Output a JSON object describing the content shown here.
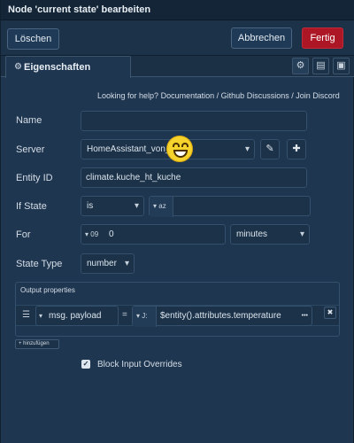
{
  "window": {
    "title": "Node 'current state' bearbeiten"
  },
  "toolbar": {
    "delete_label": "Löschen",
    "cancel_label": "Abbrechen",
    "done_label": "Fertig",
    "done_color": "#ad1625"
  },
  "tabs": {
    "properties_label": "Eigenschaften"
  },
  "help": {
    "prefix": "Looking for help?",
    "documentation": "Documentation",
    "github": "Github Discussions",
    "discord": "Join Discord",
    "separator": "/"
  },
  "form": {
    "name": {
      "label": "Name",
      "value": ""
    },
    "server": {
      "label": "Server",
      "value": "HomeAssistant_von_"
    },
    "entity_id": {
      "label": "Entity ID",
      "value": "climate.kuche_ht_kuche"
    },
    "if_state": {
      "label": "If State",
      "operator": "is",
      "type_icon": "az",
      "value": ""
    },
    "for": {
      "label": "For",
      "type_icon": "09",
      "value": "0",
      "unit": "minutes"
    },
    "state_type": {
      "label": "State Type",
      "value": "number"
    }
  },
  "output": {
    "title": "Output properties",
    "rows": [
      {
        "target": "msg. payload",
        "equals": "=",
        "type_icon": "J:",
        "value": "$entity().attributes.temperature",
        "more": "•••"
      }
    ],
    "add_label": "+ hinzufügen"
  },
  "block_input": {
    "label": "Block Input Overrides",
    "checked": true
  },
  "icons": {
    "gear": "gear-icon",
    "description": "description-icon",
    "appearance": "appearance-icon",
    "pencil": "pencil-icon",
    "plus": "plus-icon",
    "chevron": "chevron-down-icon",
    "grip": "drag-handle-icon",
    "close": "close-icon",
    "emoji": "grinning-emoji"
  }
}
